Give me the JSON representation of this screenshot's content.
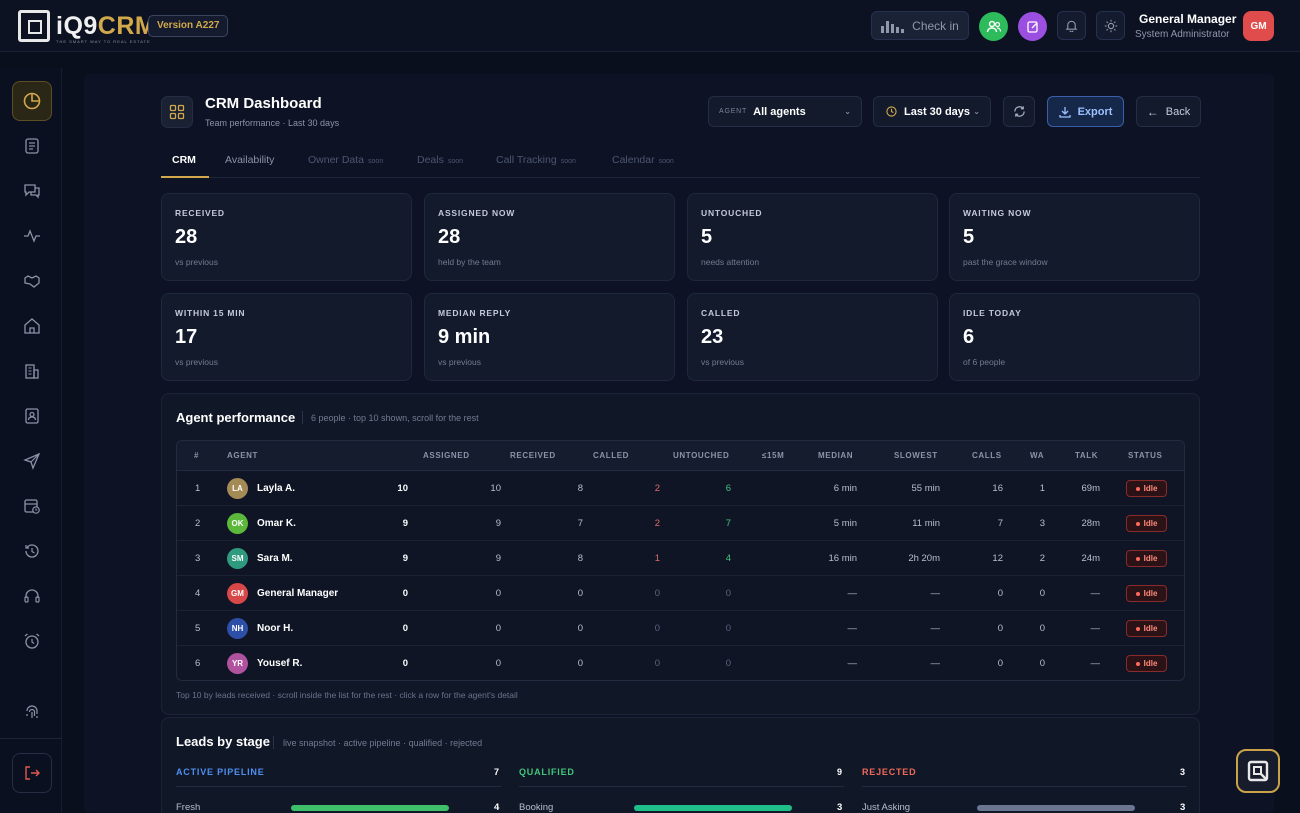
{
  "app": {
    "brand_part1": "iQ9",
    "brand_part2": "CRM",
    "tagline": "THE SMART WAY TO REAL ESTATE",
    "version": "Version A227"
  },
  "topbar": {
    "checkin_label": "Check in",
    "user_name": "General Manager",
    "user_role": "System Administrator",
    "user_initials": "GM",
    "icons": [
      "team-icon",
      "edit-note-icon",
      "bell-icon",
      "sun-icon"
    ]
  },
  "sidebar": {
    "items": [
      "dashboard-icon",
      "ledger-icon",
      "chat-icon",
      "activity-icon",
      "handshake-icon",
      "home-icon",
      "building-icon",
      "contacts-icon",
      "send-icon",
      "calendar-clock-icon",
      "history-icon",
      "headset-icon",
      "alarm-icon",
      "fingerprint-icon",
      "logout-icon"
    ]
  },
  "header": {
    "title": "CRM Dashboard",
    "subtitle": "Team performance · Last 30 days",
    "agent_label": "AGENT",
    "agent_value": "All agents",
    "range_value": "Last 30 days",
    "export_label": "Export",
    "back_label": "Back"
  },
  "tabs": [
    {
      "label": "CRM",
      "soon": ""
    },
    {
      "label": "Availability",
      "soon": ""
    },
    {
      "label": "Owner Data",
      "soon": "soon"
    },
    {
      "label": "Deals",
      "soon": "soon"
    },
    {
      "label": "Call Tracking",
      "soon": "soon"
    },
    {
      "label": "Calendar",
      "soon": "soon"
    }
  ],
  "kpis": [
    {
      "label": "RECEIVED",
      "value": "28",
      "hint": "vs previous"
    },
    {
      "label": "ASSIGNED NOW",
      "value": "28",
      "hint": "held by the team"
    },
    {
      "label": "UNTOUCHED",
      "value": "5",
      "hint": "needs attention"
    },
    {
      "label": "WAITING NOW",
      "value": "5",
      "hint": "past the grace window"
    },
    {
      "label": "WITHIN 15 MIN",
      "value": "17",
      "hint": "vs previous"
    },
    {
      "label": "MEDIAN REPLY",
      "value": "9 min",
      "hint": "vs previous"
    },
    {
      "label": "CALLED",
      "value": "23",
      "hint": "vs previous"
    },
    {
      "label": "IDLE TODAY",
      "value": "6",
      "hint": "of 6 people"
    }
  ],
  "agent_performance": {
    "title": "Agent performance",
    "subtitle": "6 people · top 10 shown, scroll for the rest",
    "columns": [
      "#",
      "AGENT",
      "ASSIGNED",
      "RECEIVED",
      "CALLED",
      "UNTOUCHED",
      "≤15M",
      "MEDIAN",
      "SLOWEST",
      "CALLS",
      "WA",
      "TALK",
      "STATUS"
    ],
    "rows": [
      {
        "n": "1",
        "initials": "LA",
        "color": "#a48a55",
        "name": "Layla A.",
        "assigned": "10",
        "received": "10",
        "called": "8",
        "untouched": "2",
        "within": "6",
        "median": "6 min",
        "slowest": "55 min",
        "calls": "16",
        "wa": "1",
        "talk": "69m",
        "status": "Idle"
      },
      {
        "n": "2",
        "initials": "OK",
        "color": "#5cb83a",
        "name": "Omar K.",
        "assigned": "9",
        "received": "9",
        "called": "7",
        "untouched": "2",
        "within": "7",
        "median": "5 min",
        "slowest": "11 min",
        "calls": "7",
        "wa": "3",
        "talk": "28m",
        "status": "Idle"
      },
      {
        "n": "3",
        "initials": "SM",
        "color": "#2e9a7e",
        "name": "Sara M.",
        "assigned": "9",
        "received": "9",
        "called": "8",
        "untouched": "1",
        "within": "4",
        "median": "16 min",
        "slowest": "2h 20m",
        "calls": "12",
        "wa": "2",
        "talk": "24m",
        "status": "Idle"
      },
      {
        "n": "4",
        "initials": "GM",
        "color": "#d94848",
        "name": "General Manager",
        "assigned": "0",
        "received": "0",
        "called": "0",
        "untouched": "0",
        "within": "0",
        "median": "—",
        "slowest": "—",
        "calls": "0",
        "wa": "0",
        "talk": "—",
        "status": "Idle"
      },
      {
        "n": "5",
        "initials": "NH",
        "color": "#2e4fa8",
        "name": "Noor H.",
        "assigned": "0",
        "received": "0",
        "called": "0",
        "untouched": "0",
        "within": "0",
        "median": "—",
        "slowest": "—",
        "calls": "0",
        "wa": "0",
        "talk": "—",
        "status": "Idle"
      },
      {
        "n": "6",
        "initials": "YR",
        "color": "#b0529e",
        "name": "Yousef R.",
        "assigned": "0",
        "received": "0",
        "called": "0",
        "untouched": "0",
        "within": "0",
        "median": "—",
        "slowest": "—",
        "calls": "0",
        "wa": "0",
        "talk": "—",
        "status": "Idle"
      }
    ],
    "footnote": "Top 10 by leads received · scroll inside the list for the rest · click a row for the agent's detail"
  },
  "leads_by_stage": {
    "title": "Leads by stage",
    "subtitle": "live snapshot · active pipeline · qualified · rejected",
    "groups": [
      {
        "label": "ACTIVE PIPELINE",
        "count": "7",
        "color": "#4f8ff0",
        "stage": "Fresh",
        "stage_value": "4",
        "fill_fraction": 1.0,
        "fill_color": "#3fbf6a"
      },
      {
        "label": "QUALIFIED",
        "count": "9",
        "color": "#44c47a",
        "stage": "Booking",
        "stage_value": "3",
        "fill_fraction": 1.0,
        "fill_color": "#1fbf8a"
      },
      {
        "label": "REJECTED",
        "count": "3",
        "color": "#f06a5a",
        "stage": "Just Asking",
        "stage_value": "3",
        "fill_fraction": 1.0,
        "fill_color": "#6a7590"
      }
    ]
  }
}
